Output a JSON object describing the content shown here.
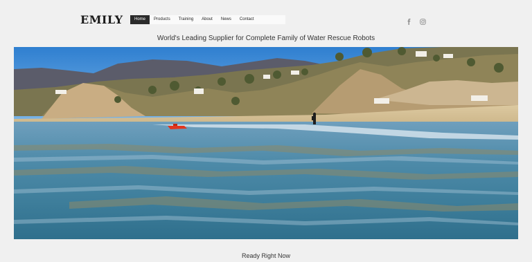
{
  "header": {
    "logo": "EMILY",
    "nav": [
      {
        "label": "Home",
        "active": true
      },
      {
        "label": "Products",
        "active": false
      },
      {
        "label": "Training",
        "active": false
      },
      {
        "label": "About",
        "active": false
      },
      {
        "label": "News",
        "active": false
      },
      {
        "label": "Contact",
        "active": false
      }
    ],
    "social": [
      "facebook-icon",
      "instagram-icon"
    ]
  },
  "tagline": "World's Leading Supplier for Complete Family of Water Rescue Robots",
  "hero": {
    "image": "water-rescue-robot-on-ocean-photo"
  },
  "section": {
    "heading": "Ready Right Now"
  },
  "colors": {
    "background": "#f0f0f0",
    "nav_active": "#2b2b2b",
    "text": "#333333"
  }
}
